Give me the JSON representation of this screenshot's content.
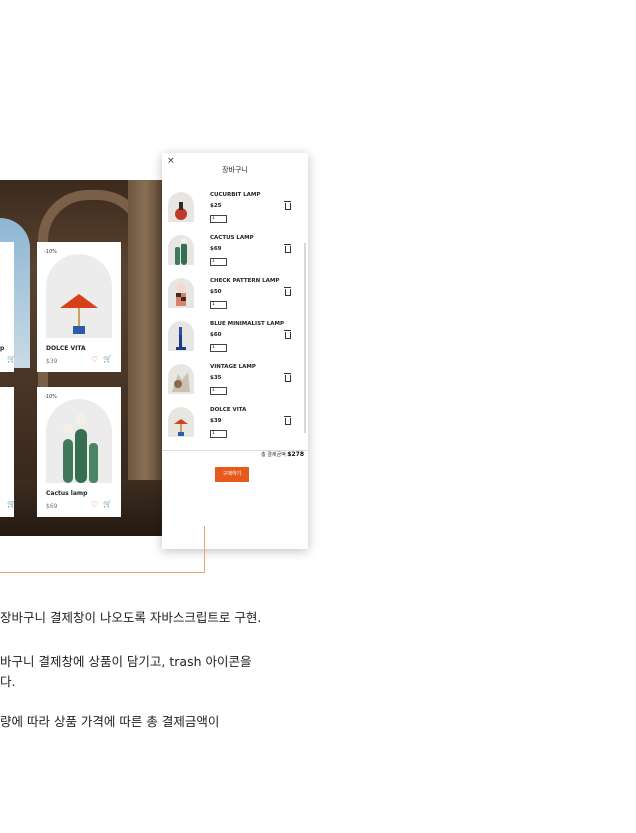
{
  "cards": [
    {
      "badge": "-10%",
      "name": "DOLCE VITA",
      "price": "$39"
    },
    {
      "badge": "-10%",
      "name": "Cactus lamp",
      "price": "$69"
    }
  ],
  "left_card_fragment": {
    "name_tail": "p"
  },
  "panel": {
    "close": "×",
    "title": "장바구니",
    "items": [
      {
        "name": "CUCURBIT LAMP",
        "price": "$25",
        "qty": "1"
      },
      {
        "name": "CACTUS LAMP",
        "price": "$69",
        "qty": "1"
      },
      {
        "name": "CHECK PATTERN LAMP",
        "price": "$50",
        "qty": "1"
      },
      {
        "name": "BLUE MINIMALIST LAMP",
        "price": "$60",
        "qty": "1"
      },
      {
        "name": "VINTAGE LAMP",
        "price": "$35",
        "qty": "1"
      },
      {
        "name": "DOLCE VITA",
        "price": "$39",
        "qty": "1"
      }
    ],
    "total_label": "총 결제금액",
    "total_value": "$278",
    "buy_label": "구매하기"
  },
  "description": {
    "line1": "장바구니 결제창이 나오도록 자바스크립트로 구현.",
    "line2": "바구니 결제창에 상품이 담기고,  trash 아이콘을",
    "line3": "다.",
    "line4": "량에 따라 상품 가격에 따른 총 결제금액이"
  },
  "colors": {
    "accent": "#e85a1c",
    "line": "#f2a070"
  }
}
